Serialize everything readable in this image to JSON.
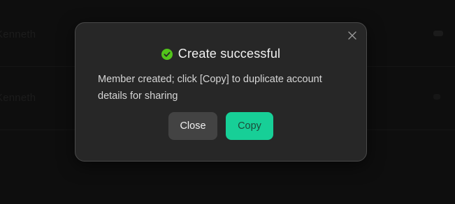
{
  "background": {
    "row_text": [
      "Kenneth",
      "Kenneth"
    ]
  },
  "dialog": {
    "title": "Create successful",
    "message": "Member created; click [Copy] to duplicate account details for sharing",
    "close_label": "Close",
    "copy_label": "Copy",
    "icons": {
      "status": "check-circle-icon",
      "dismiss": "close-icon"
    }
  },
  "colors": {
    "accent": "#17cf97",
    "success": "#52c41a",
    "dialog_bg": "#272727",
    "secondary_button": "#434343",
    "page_bg": "#0e0e0e"
  }
}
